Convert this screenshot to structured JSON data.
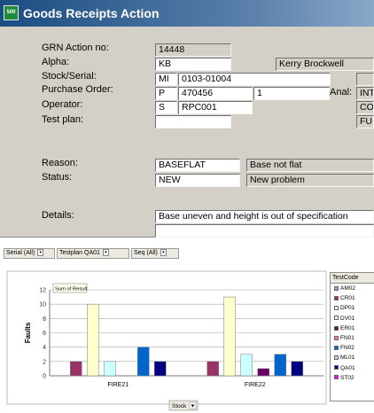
{
  "window": {
    "title": "Goods Receipts Action",
    "icon_text": "500"
  },
  "form": {
    "grn_label": "GRN Action no:",
    "grn_value": "14448",
    "alpha_label": "Alpha:",
    "alpha_value": "KB",
    "alpha_name": "Kerry Brockwell",
    "stock_label": "Stock/Serial:",
    "stock_prefix": "MI",
    "stock_value": "0103-01004",
    "po_label": "Purchase Order:",
    "po_prefix": "P",
    "po_value": "470456",
    "po_line": "1",
    "anal_label": "Anal:",
    "anal_value_1": "INT",
    "anal_value_2": "CO",
    "anal_value_3": "FUI",
    "operator_label": "Operator:",
    "operator_prefix": "S",
    "operator_value": "RPC001",
    "testplan_label": "Test plan:",
    "testplan_value": "",
    "reason_label": "Reason:",
    "reason_code": "BASEFLAT",
    "reason_desc": "Base not flat",
    "status_label": "Status:",
    "status_code": "NEW",
    "status_desc": "New problem",
    "details_label": "Details:",
    "details_value": "Base uneven and height is out of specification",
    "details_value_2": ""
  },
  "pivot": {
    "filters": [
      {
        "label": "Serial",
        "value": "(All)"
      },
      {
        "label": "Testplan",
        "value": "QA01"
      },
      {
        "label": "Seq",
        "value": "(All)"
      }
    ],
    "data_field": "Sum of Result",
    "row_field": "Stock",
    "legend_title": "TestCode",
    "legend_items": [
      {
        "name": "AM02",
        "color": "#9999ff"
      },
      {
        "name": "CR01",
        "color": "#993366"
      },
      {
        "name": "DP01",
        "color": "#ffffcc"
      },
      {
        "name": "DV01",
        "color": "#ccffff"
      },
      {
        "name": "ER01",
        "color": "#660066"
      },
      {
        "name": "FN01",
        "color": "#ff8080"
      },
      {
        "name": "FN02",
        "color": "#0066cc"
      },
      {
        "name": "ML01",
        "color": "#ccccff"
      },
      {
        "name": "QA01",
        "color": "#000080"
      },
      {
        "name": "ST02",
        "color": "#ff00ff"
      }
    ]
  },
  "chart_data": {
    "type": "bar",
    "categories": [
      "FIRE21",
      "FIRE22"
    ],
    "ylabel": "Faults",
    "xlabel": "Stock",
    "ylim": [
      0,
      12
    ],
    "yticks": [
      0,
      2,
      4,
      6,
      8,
      10,
      12
    ],
    "grid": true,
    "legend_position": "right",
    "series": [
      {
        "name": "CR01",
        "color": "#993366",
        "values": [
          2,
          2
        ]
      },
      {
        "name": "DP01",
        "color": "#ffffcc",
        "values": [
          10,
          11
        ]
      },
      {
        "name": "DV01",
        "color": "#ccffff",
        "values": [
          2,
          3
        ]
      },
      {
        "name": "ER01",
        "color": "#660066",
        "values": [
          0,
          1
        ]
      },
      {
        "name": "FN02",
        "color": "#0066cc",
        "values": [
          4,
          3
        ]
      },
      {
        "name": "QA01",
        "color": "#000080",
        "values": [
          2,
          2
        ]
      }
    ]
  }
}
